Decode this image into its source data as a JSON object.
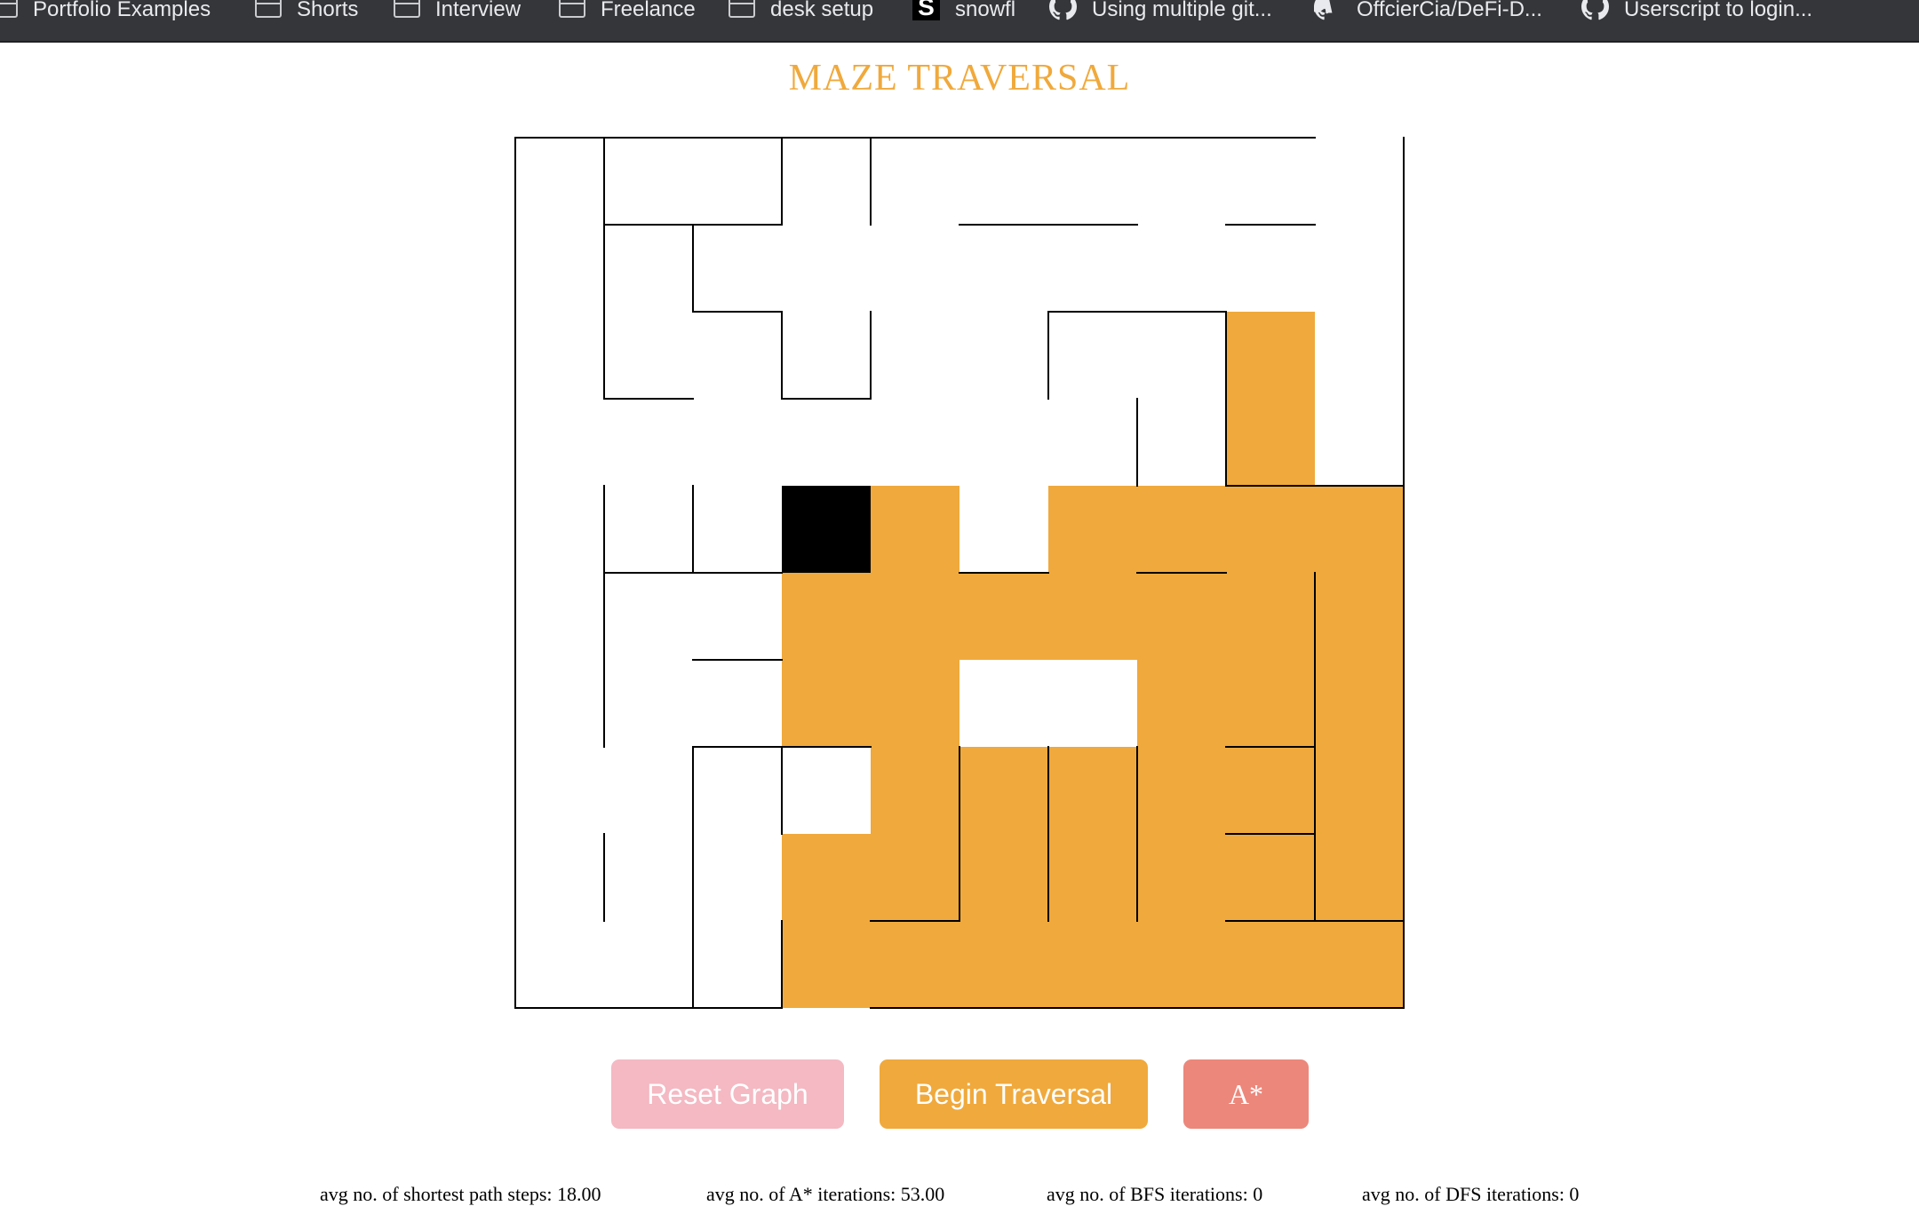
{
  "bookmarks": [
    {
      "label": "Portfolio Examples",
      "icon": "folder-icon"
    },
    {
      "label": "Shorts",
      "icon": "folder-icon"
    },
    {
      "label": "Interview",
      "icon": "folder-icon"
    },
    {
      "label": "Freelance",
      "icon": "folder-icon"
    },
    {
      "label": "desk setup",
      "icon": "folder-icon"
    },
    {
      "label": "snowfl",
      "icon": "snowfl-s-icon"
    },
    {
      "label": "Using multiple git...",
      "icon": "github-icon"
    },
    {
      "label": "OffcierCia/DeFi-D...",
      "icon": "github-icon"
    },
    {
      "label": "Userscript to login...",
      "icon": "github-icon"
    }
  ],
  "title": "MAZE TRAVERSAL",
  "maze": {
    "rows": 10,
    "cols": 10,
    "colors": {
      "background": "#ffffff",
      "wall": "#000000",
      "visited": "#f0a93c",
      "current": "#000000"
    },
    "current_cell": [
      4,
      3
    ],
    "visited_cells": [
      [
        2,
        8
      ],
      [
        3,
        8
      ],
      [
        4,
        4
      ],
      [
        4,
        6
      ],
      [
        4,
        7
      ],
      [
        4,
        8
      ],
      [
        4,
        9
      ],
      [
        5,
        3
      ],
      [
        5,
        4
      ],
      [
        5,
        5
      ],
      [
        5,
        6
      ],
      [
        5,
        7
      ],
      [
        5,
        8
      ],
      [
        5,
        9
      ],
      [
        6,
        3
      ],
      [
        6,
        4
      ],
      [
        6,
        7
      ],
      [
        6,
        8
      ],
      [
        6,
        9
      ],
      [
        7,
        4
      ],
      [
        7,
        5
      ],
      [
        7,
        6
      ],
      [
        7,
        7
      ],
      [
        7,
        8
      ],
      [
        7,
        9
      ],
      [
        8,
        3
      ],
      [
        8,
        4
      ],
      [
        8,
        5
      ],
      [
        8,
        6
      ],
      [
        8,
        7
      ],
      [
        8,
        8
      ],
      [
        8,
        9
      ],
      [
        9,
        3
      ],
      [
        9,
        4
      ],
      [
        9,
        5
      ],
      [
        9,
        6
      ],
      [
        9,
        7
      ],
      [
        9,
        8
      ],
      [
        9,
        9
      ]
    ],
    "h_walls": [
      [
        0,
        0
      ],
      [
        0,
        1
      ],
      [
        0,
        2
      ],
      [
        0,
        3
      ],
      [
        0,
        4
      ],
      [
        0,
        5
      ],
      [
        0,
        6
      ],
      [
        0,
        7
      ],
      [
        0,
        8
      ],
      [
        1,
        1
      ],
      [
        1,
        2
      ],
      [
        1,
        5
      ],
      [
        1,
        6
      ],
      [
        1,
        8
      ],
      [
        2,
        2
      ],
      [
        2,
        6
      ],
      [
        2,
        7
      ],
      [
        3,
        1
      ],
      [
        3,
        3
      ],
      [
        4,
        8
      ],
      [
        4,
        9
      ],
      [
        5,
        1
      ],
      [
        5,
        2
      ],
      [
        5,
        5
      ],
      [
        5,
        7
      ],
      [
        6,
        2
      ],
      [
        7,
        2
      ],
      [
        7,
        3
      ],
      [
        7,
        8
      ],
      [
        8,
        8
      ],
      [
        9,
        4
      ],
      [
        9,
        8
      ],
      [
        9,
        9
      ],
      [
        10,
        0
      ],
      [
        10,
        1
      ],
      [
        10,
        2
      ],
      [
        10,
        4
      ],
      [
        10,
        5
      ],
      [
        10,
        6
      ],
      [
        10,
        7
      ],
      [
        10,
        8
      ],
      [
        10,
        9
      ]
    ],
    "v_walls": [
      [
        0,
        0
      ],
      [
        0,
        1
      ],
      [
        0,
        3
      ],
      [
        0,
        4
      ],
      [
        0,
        10
      ],
      [
        1,
        0
      ],
      [
        1,
        1
      ],
      [
        1,
        2
      ],
      [
        1,
        10
      ],
      [
        2,
        0
      ],
      [
        2,
        1
      ],
      [
        2,
        3
      ],
      [
        2,
        4
      ],
      [
        2,
        6
      ],
      [
        2,
        8
      ],
      [
        2,
        10
      ],
      [
        3,
        0
      ],
      [
        3,
        7
      ],
      [
        3,
        8
      ],
      [
        3,
        10
      ],
      [
        4,
        0
      ],
      [
        4,
        1
      ],
      [
        4,
        2
      ],
      [
        4,
        10
      ],
      [
        5,
        0
      ],
      [
        5,
        1
      ],
      [
        5,
        9
      ],
      [
        5,
        10
      ],
      [
        6,
        0
      ],
      [
        6,
        1
      ],
      [
        6,
        9
      ],
      [
        6,
        10
      ],
      [
        7,
        0
      ],
      [
        7,
        2
      ],
      [
        7,
        3
      ],
      [
        7,
        5
      ],
      [
        7,
        6
      ],
      [
        7,
        7
      ],
      [
        7,
        9
      ],
      [
        7,
        10
      ],
      [
        8,
        0
      ],
      [
        8,
        1
      ],
      [
        8,
        2
      ],
      [
        8,
        5
      ],
      [
        8,
        6
      ],
      [
        8,
        7
      ],
      [
        8,
        9
      ],
      [
        8,
        10
      ],
      [
        9,
        0
      ],
      [
        9,
        2
      ],
      [
        9,
        3
      ],
      [
        9,
        10
      ]
    ]
  },
  "buttons": {
    "reset": "Reset Graph",
    "begin": "Begin Traversal",
    "algorithm": "A*"
  },
  "stats": {
    "shortest_path": "avg no. of shortest path steps: 18.00",
    "astar": "avg no. of A* iterations: 53.00",
    "bfs": "avg no. of BFS iterations: 0",
    "dfs": "avg no. of DFS iterations: 0"
  }
}
